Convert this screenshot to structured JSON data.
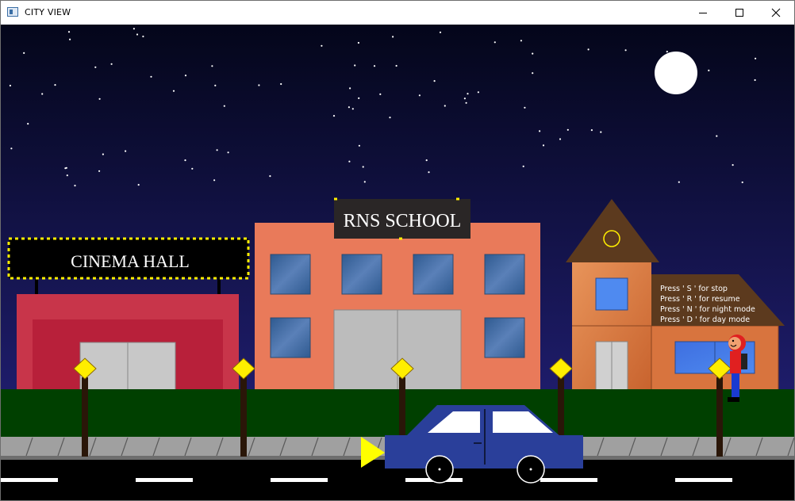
{
  "window": {
    "title": "CITY VIEW",
    "icons": {
      "app": "app-window-icon",
      "minimize": "minimize-icon",
      "maximize": "maximize-icon",
      "close": "close-icon"
    }
  },
  "scene": {
    "mode": "night",
    "colors": {
      "sky_top": "#04061a",
      "sky_bottom": "#1e1c6a",
      "moon": "#ffffff",
      "grass": "#004000",
      "sidewalk": "#a0a0a0",
      "road": "#000000",
      "cinema_wall": "#c8354a",
      "school_wall": "#e97a5a",
      "house_wall": "#d8743e",
      "roof": "#5c3a1e",
      "car_body": "#2a3f9a",
      "lamp_light": "#ffee00",
      "car_headlight": "#ffff00"
    },
    "cinema": {
      "sign": "CINEMA HALL"
    },
    "school": {
      "sign": "RNS SCHOOL"
    },
    "instructions": [
      "Press ' S ' for stop",
      "Press ' R ' for resume",
      "Press ' N ' for night mode",
      "Press ' D ' for day mode"
    ]
  }
}
